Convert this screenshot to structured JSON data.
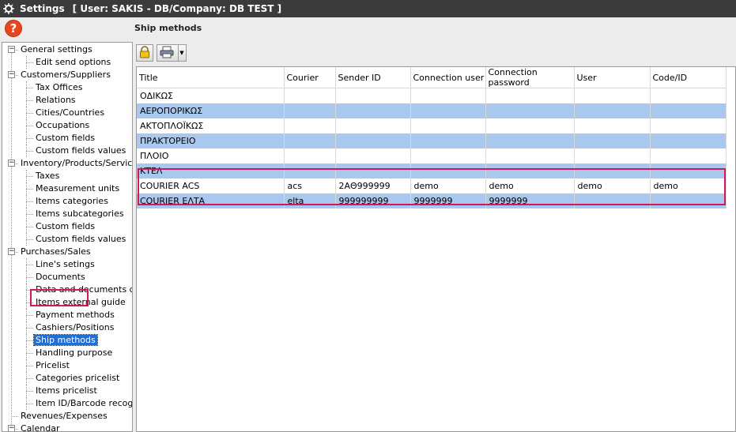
{
  "window": {
    "title": "Settings",
    "user_info": "[ User: SAKIS - DB/Company: DB TEST ]"
  },
  "help": {
    "label": "?"
  },
  "page": {
    "title": "Ship methods"
  },
  "toolbar": {
    "lock_icon": "lock-icon",
    "print_icon": "printer-icon"
  },
  "tree": {
    "items": [
      {
        "label": "General settings",
        "level": 0,
        "expander": "−"
      },
      {
        "label": "Edit send options",
        "level": 1
      },
      {
        "label": "Customers/Suppliers",
        "level": 0,
        "expander": "−"
      },
      {
        "label": "Tax Offices",
        "level": 1
      },
      {
        "label": "Relations",
        "level": 1
      },
      {
        "label": "Cities/Countries",
        "level": 1
      },
      {
        "label": "Occupations",
        "level": 1
      },
      {
        "label": "Custom fields",
        "level": 1
      },
      {
        "label": "Custom fields values",
        "level": 1
      },
      {
        "label": "Inventory/Products/Services",
        "level": 0,
        "expander": "−"
      },
      {
        "label": "Taxes",
        "level": 1
      },
      {
        "label": "Measurement units",
        "level": 1
      },
      {
        "label": "Items categories",
        "level": 1
      },
      {
        "label": "Items subcategories",
        "level": 1
      },
      {
        "label": "Custom fields",
        "level": 1
      },
      {
        "label": "Custom fields values",
        "level": 1
      },
      {
        "label": "Purchases/Sales",
        "level": 0,
        "expander": "−"
      },
      {
        "label": "Line's setings",
        "level": 1
      },
      {
        "label": "Documents",
        "level": 1
      },
      {
        "label": "Data and documents desi",
        "level": 1
      },
      {
        "label": "Items external guide",
        "level": 1
      },
      {
        "label": "Payment methods",
        "level": 1
      },
      {
        "label": "Cashiers/Positions",
        "level": 1
      },
      {
        "label": "Ship methods",
        "level": 1,
        "selected": true
      },
      {
        "label": "Handling purpose",
        "level": 1
      },
      {
        "label": "Pricelist",
        "level": 1
      },
      {
        "label": "Categories pricelist",
        "level": 1
      },
      {
        "label": "Items pricelist",
        "level": 1
      },
      {
        "label": "Item ID/Barcode recognize",
        "level": 1
      },
      {
        "label": "Revenues/Expenses",
        "level": 0
      },
      {
        "label": "Calendar",
        "level": 0,
        "expander": "−"
      }
    ]
  },
  "grid": {
    "columns": [
      "Title",
      "Courier",
      "Sender ID",
      "Connection user",
      "Connection password",
      "User",
      "Code/ID"
    ],
    "rows": [
      [
        "ΟΔΙΚΩΣ",
        "",
        "",
        "",
        "",
        "",
        ""
      ],
      [
        "ΑΕΡΟΠΟΡΙΚΩΣ",
        "",
        "",
        "",
        "",
        "",
        ""
      ],
      [
        "ΑΚΤΟΠΛΟΪΚΩΣ",
        "",
        "",
        "",
        "",
        "",
        ""
      ],
      [
        "ΠΡΑΚΤΟΡΕΙΟ",
        "",
        "",
        "",
        "",
        "",
        ""
      ],
      [
        "ΠΛΟΙΟ",
        "",
        "",
        "",
        "",
        "",
        ""
      ],
      [
        "ΚΤΕΛ",
        "",
        "",
        "",
        "",
        "",
        ""
      ],
      [
        "COURIER ACS",
        "acs",
        "2ΑΘ999999",
        "demo",
        "demo",
        "demo",
        "demo"
      ],
      [
        "COURIER ΕΛΤΑ",
        "elta",
        "999999999",
        "9999999",
        "9999999",
        "",
        ""
      ]
    ]
  },
  "colors": {
    "selection": "#1f6fd6",
    "alt_row": "#a9c8ef",
    "highlight_border": "#d0185a",
    "help": "#e8461e"
  }
}
